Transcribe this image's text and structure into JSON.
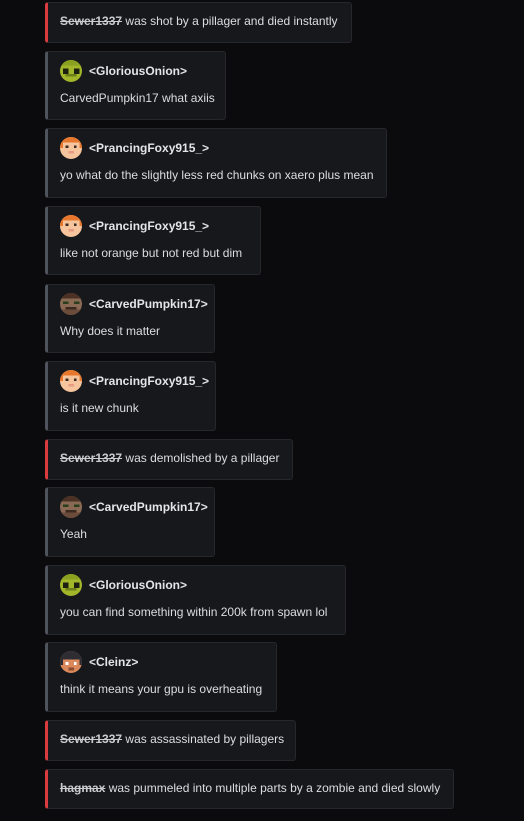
{
  "feed": {
    "items": [
      {
        "kind": "death",
        "victim": "Sewer1337",
        "text": " was shot by a pillager and died instantly"
      },
      {
        "kind": "chat",
        "author": "<GloriousOnion>",
        "message": "CarvedPumpkin17 what axiis",
        "avatar": "onion-face-icon"
      },
      {
        "kind": "chat",
        "author": "<PrancingFoxy915_>",
        "message": "yo what do the slightly less red chunks on xaero plus mean",
        "avatar": "fox-face-icon"
      },
      {
        "kind": "chat",
        "author": "<PrancingFoxy915_>",
        "message": "like not orange but not red but dim",
        "avatar": "fox-face-icon"
      },
      {
        "kind": "chat",
        "author": "<CarvedPumpkin17>",
        "message": "Why does it matter",
        "avatar": "pumpkin-face-icon"
      },
      {
        "kind": "chat",
        "author": "<PrancingFoxy915_>",
        "message": "is it new chunk",
        "avatar": "fox-face-icon"
      },
      {
        "kind": "death",
        "victim": "Sewer1337",
        "text": " was demolished by a pillager"
      },
      {
        "kind": "chat",
        "author": "<CarvedPumpkin17>",
        "message": "Yeah",
        "avatar": "pumpkin-face-icon"
      },
      {
        "kind": "chat",
        "author": "<GloriousOnion>",
        "message": "you can find something within 200k from spawn lol",
        "avatar": "onion-face-icon"
      },
      {
        "kind": "chat",
        "author": "<Cleinz>",
        "message": "think it means your gpu is overheating",
        "avatar": "cleinz-face-icon"
      },
      {
        "kind": "death",
        "victim": "Sewer1337",
        "text": " was assassinated by pillagers"
      },
      {
        "kind": "death",
        "victim": "hagmax",
        "text": " was pummeled into multiple parts by a zombie and died slowly"
      }
    ]
  },
  "colors": {
    "background": "#0b0b0d",
    "card": "#17181b",
    "death_accent": "#d83c3e",
    "chat_accent": "#4f545c"
  }
}
